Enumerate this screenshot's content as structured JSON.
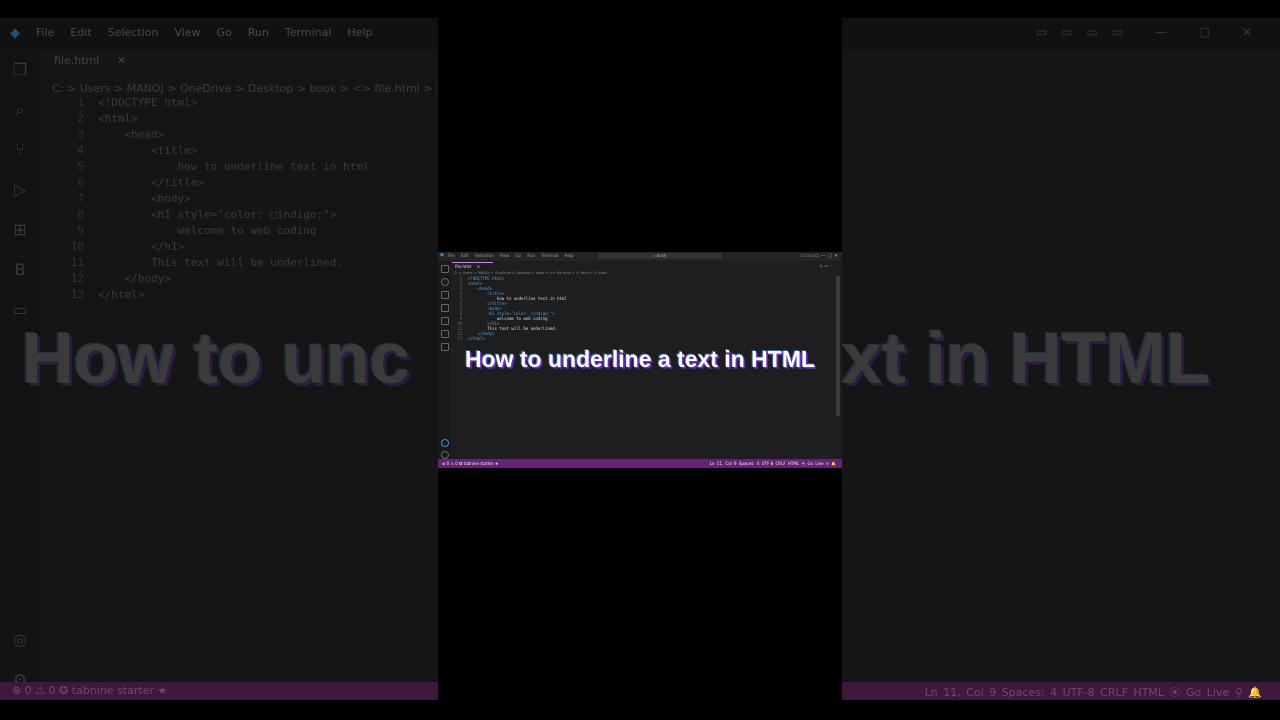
{
  "menu": [
    "File",
    "Edit",
    "Selection",
    "View",
    "Go",
    "Run",
    "Terminal",
    "Help"
  ],
  "editor": {
    "tab_name": "file.html",
    "breadcrumb_bg": "C: > Users > MANOJ > OneDrive > Desktop > book > <> file.html > ⓔ html >",
    "breadcrumb_fg": "C: > Users > MANOJ > OneDrive > Desktop > book > <> file.html > ⓔ html > ⓔ body",
    "search_text": "⌕ book",
    "lines": [
      {
        "n": "1",
        "code": "<!DOCTYPE html>"
      },
      {
        "n": "2",
        "code": "<html>"
      },
      {
        "n": "3",
        "code": "    <head>"
      },
      {
        "n": "4",
        "code": "        <title>"
      },
      {
        "n": "5",
        "code": "            how to underline text in html"
      },
      {
        "n": "6",
        "code": "        </title>"
      },
      {
        "n": "7",
        "code": "        <body>"
      },
      {
        "n": "8",
        "code": "        <h1 style=\"color: □indigo;\">"
      },
      {
        "n": "9",
        "code": "            welcome to web coding"
      },
      {
        "n": "10",
        "code": "        </h1>"
      },
      {
        "n": "11",
        "code": "        This text will be underlined."
      },
      {
        "n": "12",
        "code": "    </body>"
      },
      {
        "n": "13",
        "code": "</html>"
      }
    ]
  },
  "status": {
    "left": "⊗ 0 ⚠ 0   ✪ tabnine starter ★",
    "right": "Ln 11, Col 9   Spaces: 4   UTF-8   CRLF   HTML   ⦿ Go Live   ⚲   🔔"
  },
  "overlay": {
    "caption": "How to underline a text in HTML",
    "bg_caption_left": "How to unc",
    "bg_caption_right": "xt in HTML"
  },
  "colors": {
    "status_bar": "#68217a",
    "caption_text": "#ffffff",
    "caption_shadow": "#7a2fd0"
  }
}
